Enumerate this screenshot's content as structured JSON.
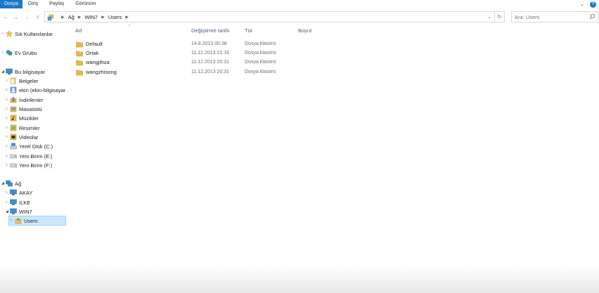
{
  "ribbon": {
    "tabs": [
      "Dosya",
      "Giriş",
      "Paylaş",
      "Görünüm"
    ],
    "active_tab": "Dosya"
  },
  "nav": {
    "breadcrumb": [
      "Ağ",
      "WIN7",
      "Users"
    ],
    "search_placeholder": "Ara: Users"
  },
  "columns": {
    "name": "Ad",
    "date": "Değiştirme tarihi",
    "type": "Tür",
    "size": "Boyut"
  },
  "files": [
    {
      "name": "Default",
      "date": "14.8.2013 00:38",
      "type": "Dosya klasörü"
    },
    {
      "name": "Ortak",
      "date": "11.12.2013 21:16",
      "type": "Dosya klasörü"
    },
    {
      "name": "wangjihua",
      "date": "11.12.2013 20:31",
      "type": "Dosya klasörü"
    },
    {
      "name": "wangzhisong",
      "date": "11.12.2013 20:31",
      "type": "Dosya klasörü"
    }
  ],
  "sidebar": {
    "favorites": "Sık Kullanılanlar",
    "homegroup": "Ev Grubu",
    "thispc": "Bu bilgisayar",
    "pc_items": [
      {
        "label": "Belgeler",
        "icon": "documents-icon"
      },
      {
        "label": "ekin (ekin-bilgisayar",
        "icon": "user-icon"
      },
      {
        "label": "İndirilenler",
        "icon": "downloads-icon"
      },
      {
        "label": "Masaüstü",
        "icon": "desktop-icon"
      },
      {
        "label": "Müzikler",
        "icon": "music-icon"
      },
      {
        "label": "Resimler",
        "icon": "pictures-icon"
      },
      {
        "label": "Videolar",
        "icon": "videos-icon"
      },
      {
        "label": "Yerel Disk (C:)",
        "icon": "local-disk-icon"
      },
      {
        "label": "Yeni Birim (E:)",
        "icon": "drive-icon"
      },
      {
        "label": "Yeni Birim (F:)",
        "icon": "drive-icon"
      }
    ],
    "network": "Ağ",
    "network_items": [
      {
        "label": "AKAY"
      },
      {
        "label": "ILKE"
      },
      {
        "label": "WIN7"
      }
    ],
    "selected": "Users"
  },
  "colors": {
    "accent": "#1979ca",
    "selection_bg": "#cce8ff",
    "selection_border": "#99d1ff",
    "folder": "#e8b94a"
  }
}
